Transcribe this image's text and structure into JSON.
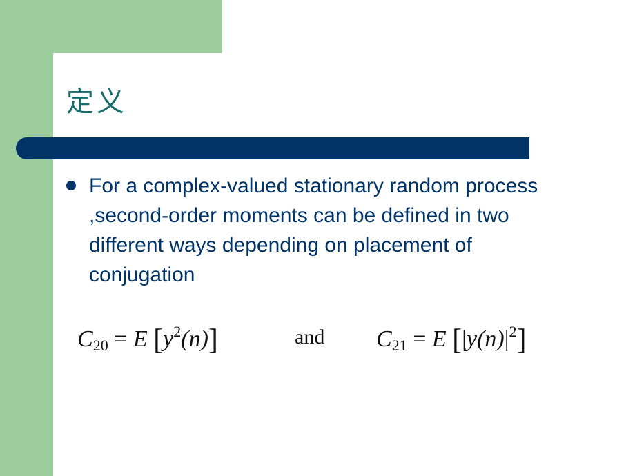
{
  "slide": {
    "title": "定义",
    "bullets": [
      "For a complex-valued stationary random process ,second-order moments can be defined in two different ways depending on placement of conjugation"
    ],
    "formula_1": {
      "lhs_symbol": "C",
      "lhs_sub": "20",
      "equals": "=",
      "operator": "E",
      "open": "[",
      "var": "y",
      "power": "2",
      "arg": "(n)",
      "close": "]"
    },
    "connector": "and",
    "formula_2": {
      "lhs_symbol": "C",
      "lhs_sub": "21",
      "equals": "=",
      "operator": "E",
      "open": "[",
      "abs_open": "|",
      "var": "y",
      "arg": "(n)",
      "abs_close": "|",
      "power": "2",
      "close": "]"
    },
    "colors": {
      "green": "#9dcd9d",
      "navy": "#003366",
      "title_teal": "#1a6b6b"
    }
  }
}
